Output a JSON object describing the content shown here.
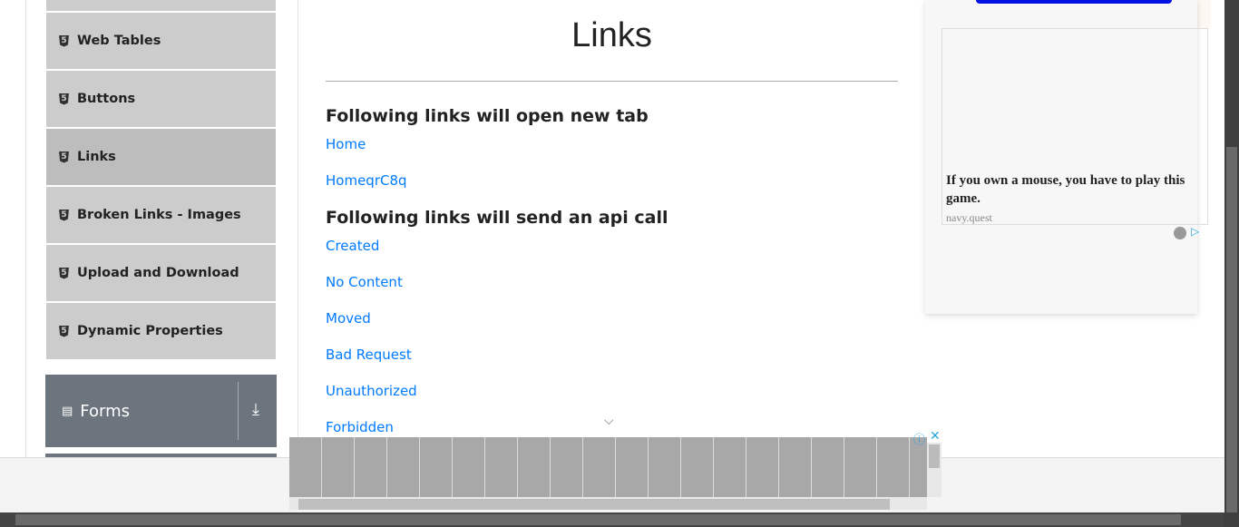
{
  "sidebar": {
    "items": [
      {
        "label": ""
      },
      {
        "label": "Web Tables"
      },
      {
        "label": "Buttons"
      },
      {
        "label": "Links",
        "active": true
      },
      {
        "label": "Broken Links - Images"
      },
      {
        "label": "Upload and Download"
      },
      {
        "label": "Dynamic Properties"
      }
    ],
    "group": {
      "label": "Forms"
    }
  },
  "main": {
    "title": "Links",
    "section1": "Following links will open new tab",
    "links1": [
      "Home",
      "HomeqrC8q"
    ],
    "section2": "Following links will send an api call",
    "links2": [
      "Created",
      "No Content",
      "Moved",
      "Bad Request",
      "Unauthorized",
      "Forbidden"
    ]
  },
  "ad_right": {
    "headline": "If you own a mouse, you have to play this game.",
    "source": "navy.quest"
  },
  "colors": {
    "link": "#007bff",
    "sidebar": "#cccccc",
    "active": "#bdbdbd",
    "group": "#6c757d"
  }
}
